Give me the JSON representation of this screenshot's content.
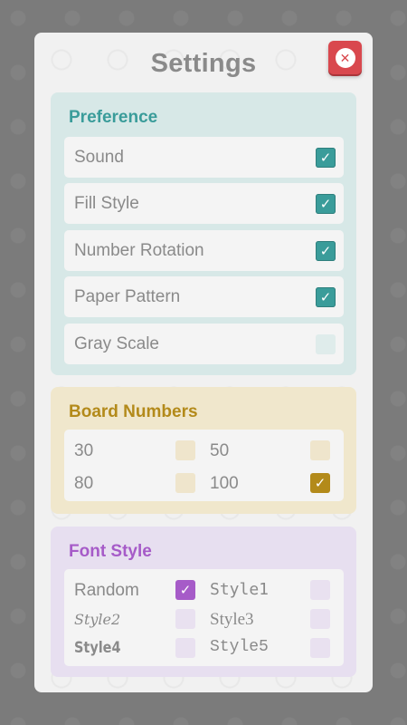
{
  "dialog": {
    "title": "Settings",
    "close_icon": "close-x-icon"
  },
  "preference": {
    "title": "Preference",
    "items": [
      {
        "label": "Sound",
        "checked": true
      },
      {
        "label": "Fill Style",
        "checked": true
      },
      {
        "label": "Number Rotation",
        "checked": true
      },
      {
        "label": "Paper Pattern",
        "checked": true
      },
      {
        "label": "Gray Scale",
        "checked": false
      }
    ]
  },
  "board_numbers": {
    "title": "Board Numbers",
    "options": [
      {
        "label": "30",
        "checked": false
      },
      {
        "label": "50",
        "checked": false
      },
      {
        "label": "80",
        "checked": false
      },
      {
        "label": "100",
        "checked": true
      }
    ]
  },
  "font_style": {
    "title": "Font Style",
    "options": [
      {
        "label": "Random",
        "checked": true
      },
      {
        "label": "Style1",
        "checked": false
      },
      {
        "label": "Style2",
        "checked": false
      },
      {
        "label": "Style3",
        "checked": false
      },
      {
        "label": "Style4",
        "checked": false
      },
      {
        "label": "Style5",
        "checked": false
      }
    ]
  },
  "colors": {
    "teal": "#3a9c9a",
    "gold": "#b38a1a",
    "purple": "#a65bc8",
    "close": "#d9484e"
  },
  "check_glyph": "✓"
}
